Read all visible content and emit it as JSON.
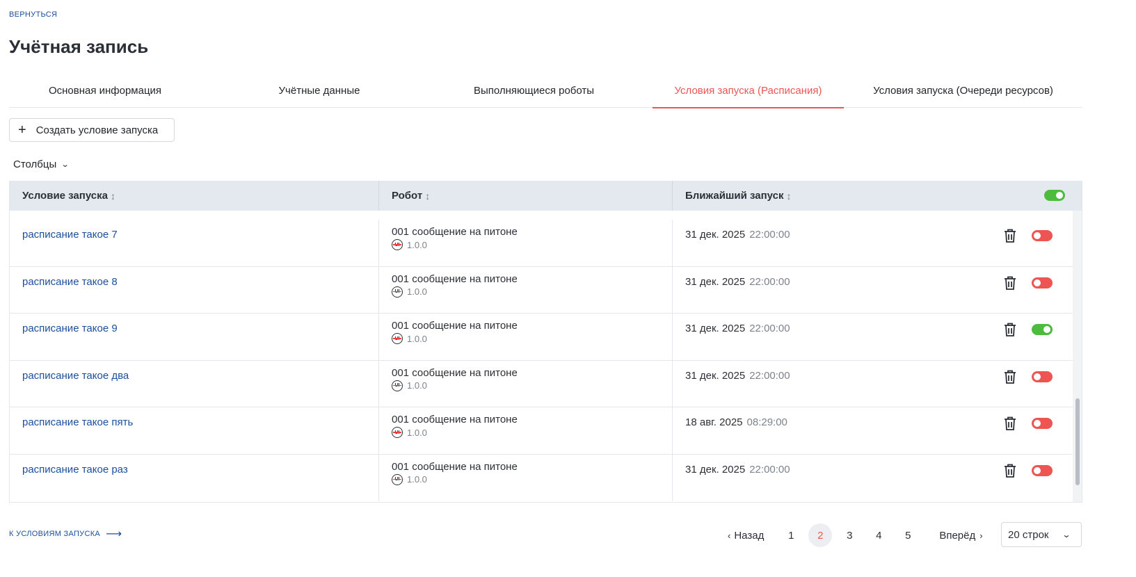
{
  "nav": {
    "back_label": "ВЕРНУТЬСЯ",
    "footer_link_label": "К УСЛОВИЯМ ЗАПУСКА"
  },
  "page": {
    "title": "Учётная запись"
  },
  "tabs": [
    {
      "label": "Основная информация",
      "active": false
    },
    {
      "label": "Учётные данные",
      "active": false
    },
    {
      "label": "Выполняющиеся роботы",
      "active": false
    },
    {
      "label": "Условия запуска (Расписания)",
      "active": true
    },
    {
      "label": "Условия запуска (Очереди ресурсов)",
      "active": false
    }
  ],
  "toolbar": {
    "create_label": "Создать условие запуска",
    "columns_label": "Столбцы"
  },
  "table": {
    "columns": [
      "Условие запуска",
      "Робот",
      "Ближайший запуск"
    ],
    "header_toggle_on": true,
    "rows": [
      {
        "name": "расписание такое 7",
        "robot": "001 сообщение на питоне",
        "version": "1.0.0",
        "date": "31 дек. 2025",
        "time": "22:00:00",
        "enabled": false
      },
      {
        "name": "расписание такое 8",
        "robot": "001 сообщение на питоне",
        "version": "1.0.0",
        "date": "31 дек. 2025",
        "time": "22:00:00",
        "enabled": false
      },
      {
        "name": "расписание такое 9",
        "robot": "001 сообщение на питоне",
        "version": "1.0.0",
        "date": "31 дек. 2025",
        "time": "22:00:00",
        "enabled": true
      },
      {
        "name": "расписание такое два",
        "robot": "001 сообщение на питоне",
        "version": "1.0.0",
        "date": "31 дек. 2025",
        "time": "22:00:00",
        "enabled": false
      },
      {
        "name": "расписание такое пять",
        "robot": "001 сообщение на питоне",
        "version": "1.0.0",
        "date": "18 авг. 2025",
        "time": "08:29:00",
        "enabled": false
      },
      {
        "name": "расписание такое раз",
        "robot": "001 сообщение на питоне",
        "version": "1.0.0",
        "date": "31 дек. 2025",
        "time": "22:00:00",
        "enabled": false
      }
    ]
  },
  "pagination": {
    "prev_label": "Назад",
    "next_label": "Вперёд",
    "pages": [
      "1",
      "2",
      "3",
      "4",
      "5"
    ],
    "current_page": "2",
    "rows_per_page": "20 строк"
  },
  "colors": {
    "accent": "#ee5552",
    "link": "#1b4f9c",
    "toggle_on": "#4cbb3e",
    "header_bg": "#e4e8ef"
  }
}
